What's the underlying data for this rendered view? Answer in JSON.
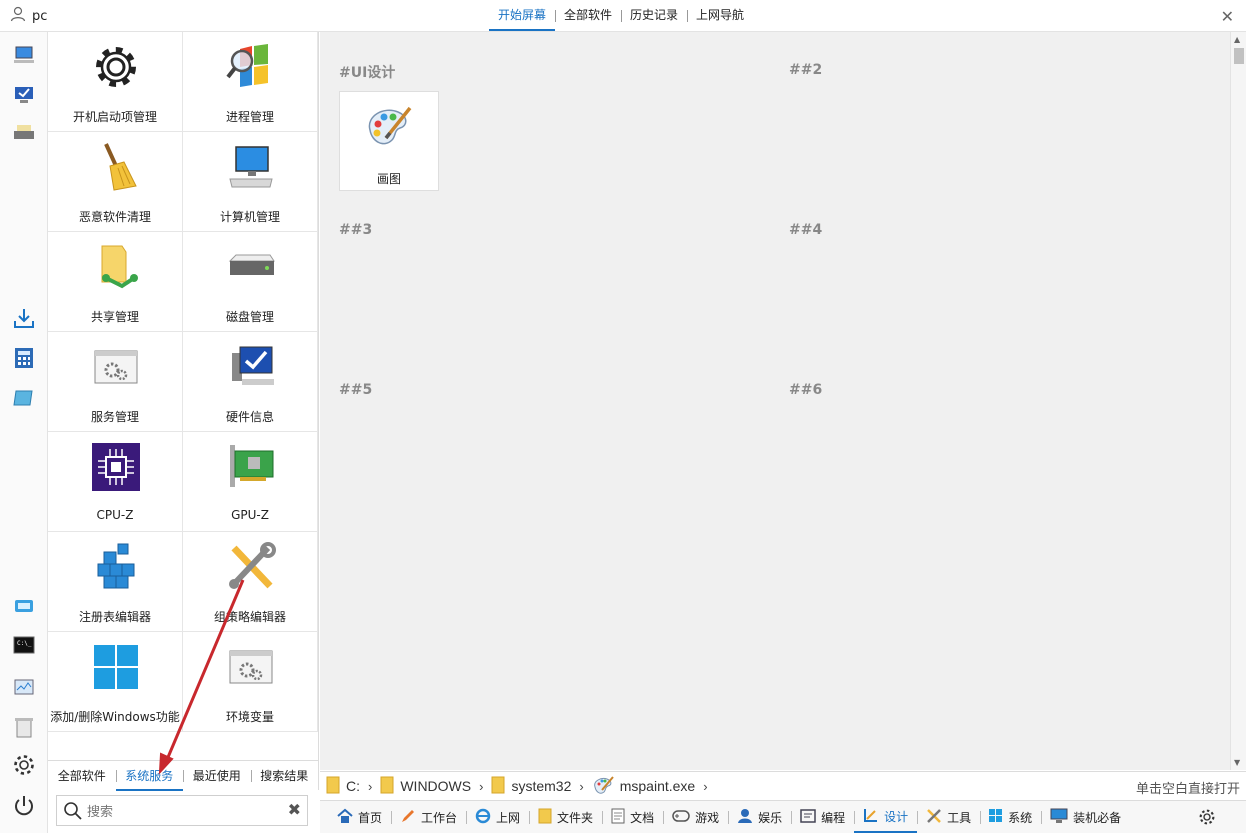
{
  "user": {
    "name": "pc"
  },
  "top_tabs": [
    {
      "label": "开始屏幕",
      "active": true
    },
    {
      "label": "全部软件",
      "active": false
    },
    {
      "label": "历史记录",
      "active": false
    },
    {
      "label": "上网导航",
      "active": false
    }
  ],
  "tools": [
    {
      "label": "开机启动项管理",
      "icon": "gear-icon"
    },
    {
      "label": "进程管理",
      "icon": "windows-magnifier-icon"
    },
    {
      "label": "恶意软件清理",
      "icon": "broom-icon"
    },
    {
      "label": "计算机管理",
      "icon": "computer-icon"
    },
    {
      "label": "共享管理",
      "icon": "shared-folder-icon"
    },
    {
      "label": "磁盘管理",
      "icon": "disk-drive-icon"
    },
    {
      "label": "服务管理",
      "icon": "services-window-icon"
    },
    {
      "label": "硬件信息",
      "icon": "hardware-check-icon"
    },
    {
      "label": "CPU-Z",
      "icon": "cpu-chip-icon"
    },
    {
      "label": "GPU-Z",
      "icon": "graphics-card-icon"
    },
    {
      "label": "注册表编辑器",
      "icon": "registry-cubes-icon"
    },
    {
      "label": "组策略编辑器",
      "icon": "tools-wrench-icon"
    },
    {
      "label": "添加/删除Windows功能",
      "icon": "windows-logo-icon"
    },
    {
      "label": "环境变量",
      "icon": "env-window-icon"
    }
  ],
  "left_tabs": [
    {
      "label": "全部软件",
      "active": false
    },
    {
      "label": "系统服务",
      "active": true
    },
    {
      "label": "最近使用",
      "active": false
    },
    {
      "label": "搜索结果",
      "active": false
    }
  ],
  "search": {
    "placeholder": "搜索"
  },
  "groups": [
    "#UI设计",
    "##2",
    "##3",
    "##4",
    "##5",
    "##6"
  ],
  "apps": [
    {
      "label": "画图",
      "icon": "paint-palette-icon"
    }
  ],
  "path": {
    "segments": [
      "C:",
      "WINDOWS",
      "system32",
      "mspaint.exe"
    ],
    "hint": "单击空白直接打开"
  },
  "taskbar": [
    {
      "label": "首页",
      "icon": "home-icon",
      "active": false
    },
    {
      "label": "工作台",
      "icon": "pencil-icon",
      "active": false
    },
    {
      "label": "上网",
      "icon": "ie-icon",
      "active": false
    },
    {
      "label": "文件夹",
      "icon": "folder-icon",
      "active": false
    },
    {
      "label": "文档",
      "icon": "document-icon",
      "active": false
    },
    {
      "label": "游戏",
      "icon": "gamepad-icon",
      "active": false
    },
    {
      "label": "娱乐",
      "icon": "media-icon",
      "active": false
    },
    {
      "label": "编程",
      "icon": "code-icon",
      "active": false
    },
    {
      "label": "设计",
      "icon": "design-icon",
      "active": true
    },
    {
      "label": "工具",
      "icon": "tools-icon",
      "active": false
    },
    {
      "label": "系统",
      "icon": "windows-icon",
      "active": false
    },
    {
      "label": "装机必备",
      "icon": "monitor-icon",
      "active": false
    }
  ],
  "colors": {
    "accent": "#1a73c4",
    "main_bg": "#f0f0f0",
    "arrow": "#c8282d"
  }
}
